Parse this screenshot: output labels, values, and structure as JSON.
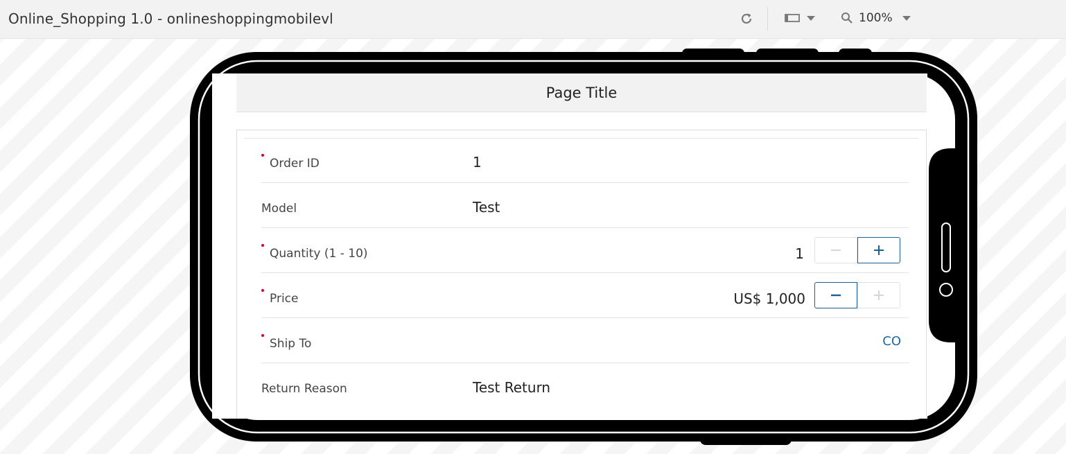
{
  "app": {
    "title": "Online_Shopping 1.0 - onlineshoppingmobilevl"
  },
  "toolbar": {
    "zoom": "100%",
    "icons": {
      "refresh": "refresh-icon",
      "device": "device-orientation-icon",
      "zoom": "magnifier-icon"
    }
  },
  "page": {
    "title": "Page Title"
  },
  "form": {
    "order_id": {
      "label": "Order ID",
      "value": "1",
      "required": true
    },
    "model": {
      "label": "Model",
      "value": "Test",
      "required": false
    },
    "quantity": {
      "label": "Quantity (1 - 10)",
      "value": "1",
      "required": true,
      "decrement_enabled": false,
      "increment_enabled": true
    },
    "price": {
      "label": "Price",
      "value": "US$ 1,000",
      "required": true,
      "decrement_enabled": true,
      "increment_enabled": false
    },
    "ship_to": {
      "label": "Ship To",
      "value": "CO",
      "required": true
    },
    "return_reason": {
      "label": "Return Reason",
      "value": "Test Return",
      "required": false
    }
  },
  "colors": {
    "required_marker": "#d4002a",
    "accent": "#1b6aa5",
    "frame": "#000000",
    "toolbar_bg": "#f2f2f2"
  }
}
